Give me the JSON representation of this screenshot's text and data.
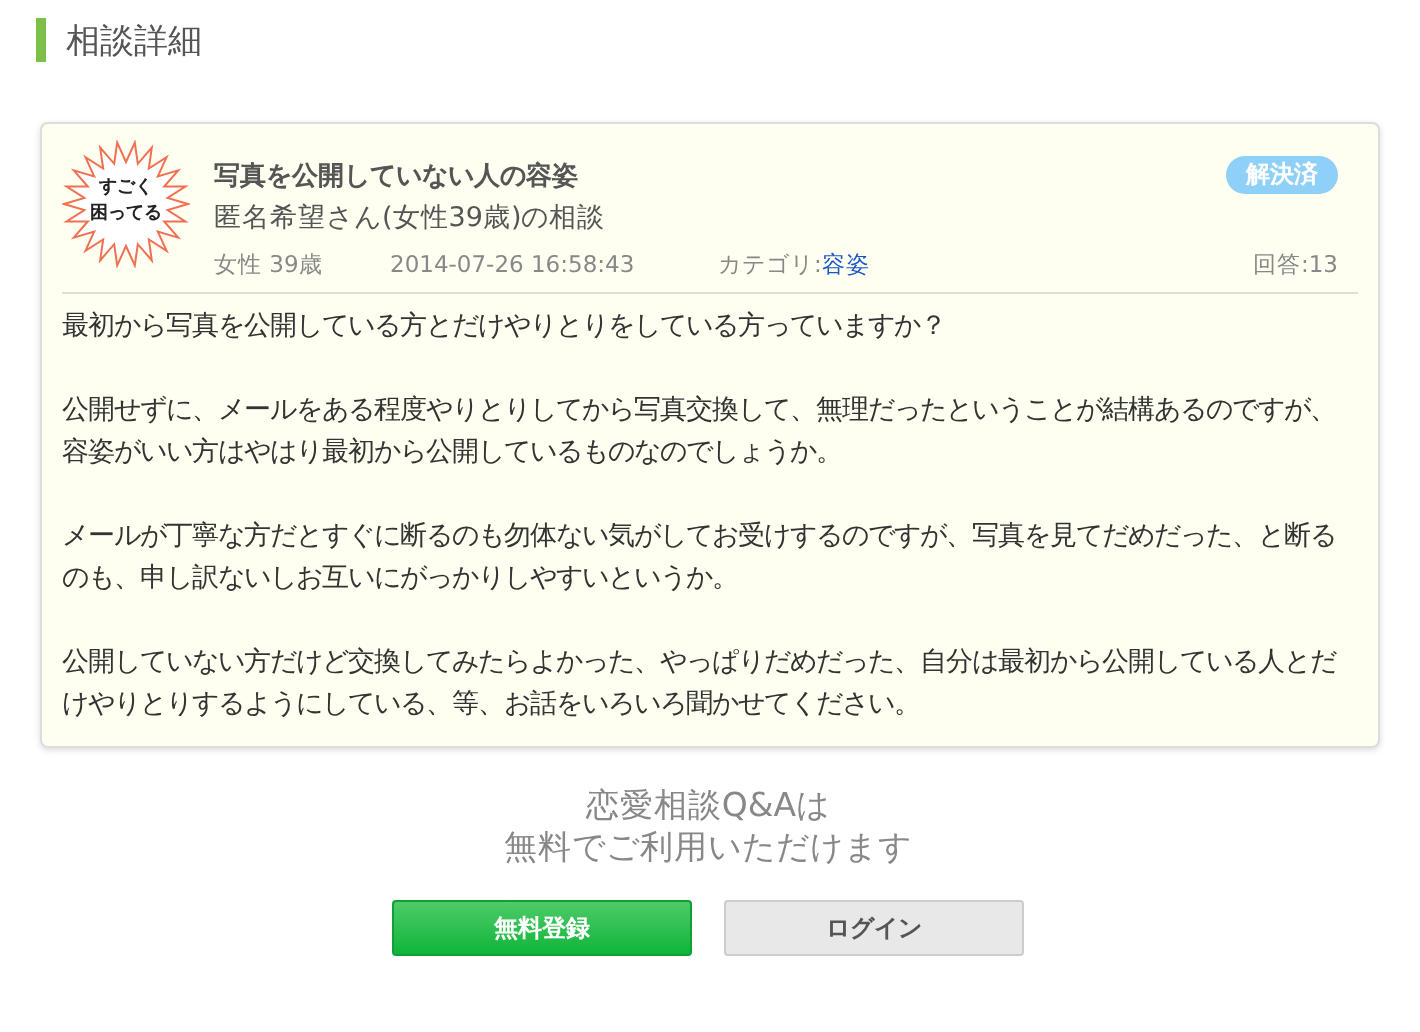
{
  "heading": "相談詳細",
  "question": {
    "badge": [
      "すごく",
      "困ってる"
    ],
    "title": "写真を公開していない人の容姿",
    "asker": "匿名希望さん(女性39歳)の相談",
    "status": "解決済",
    "resolved": true,
    "gender_age": "女性 39歳",
    "datetime": "2014-07-26 16:58:43",
    "category_label": "カテゴリ:",
    "category": "容姿",
    "answers": "回答:13",
    "paragraphs": [
      "最初から写真を公開している方とだけやりとりをしている方っていますか？",
      "公開せずに、メールをある程度やりとりしてから写真交換して、無理だったということが結構あるのですが、容姿がいい方はやはり最初から公開しているものなのでしょうか。",
      "メールが丁寧な方だとすぐに断るのも勿体ない気がしてお受けするのですが、写真を見てだめだった、と断るのも、申し訳ないしお互いにがっかりしやすいというか。",
      "公開していない方だけど交換してみたらよかった、やっぱりだめだった、自分は最初から公開している人とだけやりとりするようにしている、等、お話をいろいろ聞かせてください。"
    ]
  },
  "promo": [
    "恋愛相談Q&Aは",
    "無料でご利用いただけます"
  ],
  "buttons": [
    {
      "label": "無料登録",
      "kind": "primary"
    },
    {
      "label": "ログイン",
      "kind": "secondary"
    }
  ]
}
